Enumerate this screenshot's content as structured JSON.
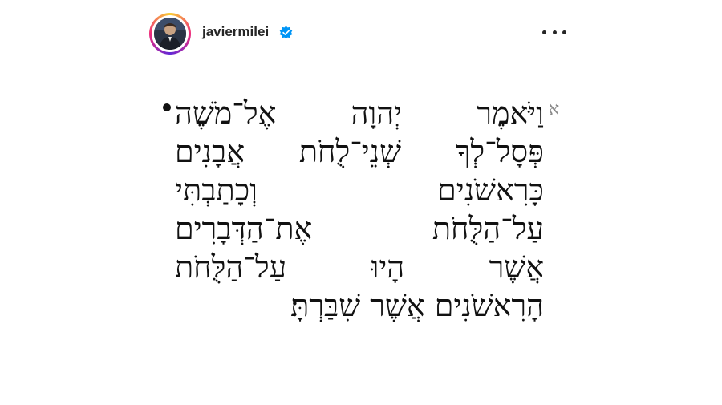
{
  "post": {
    "username": "javiermilei",
    "verified_icon": "verified-badge-icon",
    "more_icon": "more-options-icon",
    "accent_color": "#0095f6"
  },
  "verse": {
    "number": "א",
    "lines": [
      "וַיֹּאמֶר יְהוָה אֶל־מֹשֶׁה",
      "פְּסָל־לְךָ שְׁנֵי־לֻחֹת אֲבָנִים",
      "כָּרִאשֹׁנִים וְכָתַבְתִּי",
      "עַל־הַלֻּחֹת אֶת־הַדְּבָרִים",
      "אֲשֶׁר הָיוּ עַל־הַלֻּחֹת",
      "הָרִאשֹׁנִים אֲשֶׁר שִׁבַּרְתָּ׃"
    ]
  }
}
